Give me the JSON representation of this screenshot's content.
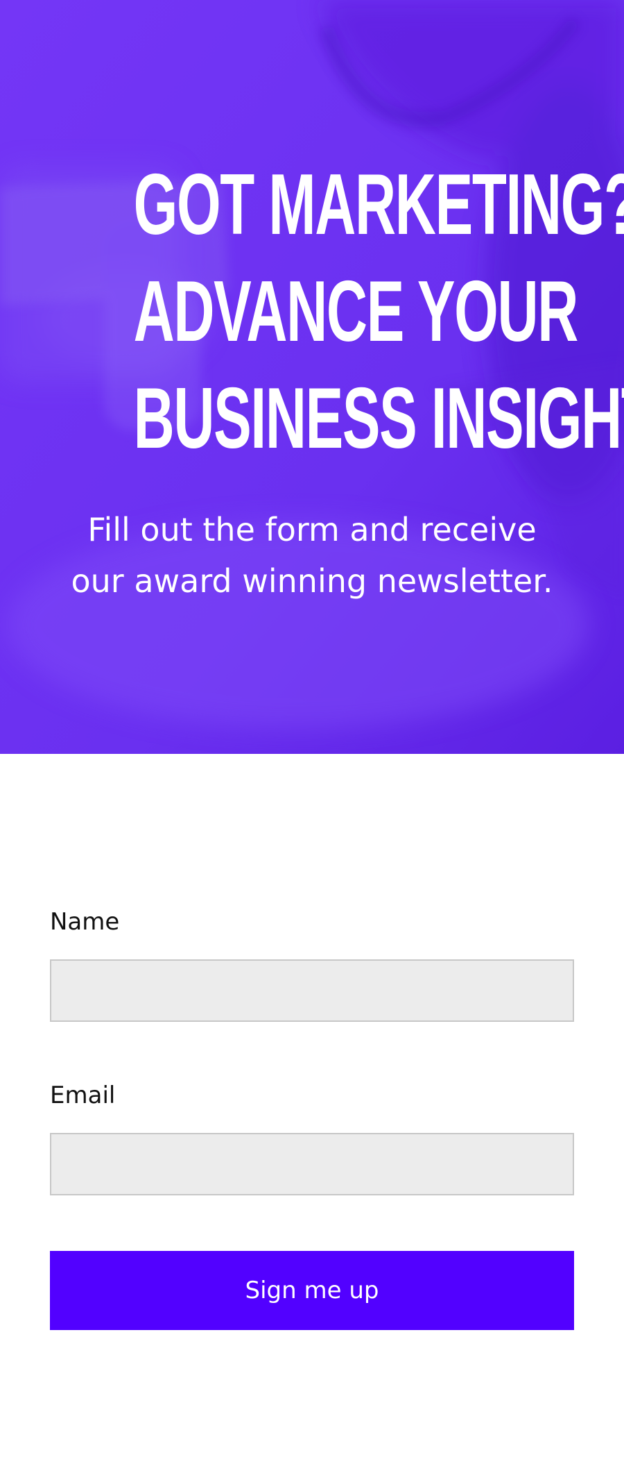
{
  "hero": {
    "headline_lines": [
      "GOT MARKETING?",
      "ADVANCE YOUR",
      "BUSINESS INSIGHT."
    ],
    "subtext_lines": [
      "Fill out the form and receive",
      "our award winning newsletter."
    ],
    "background_color": "#6f35f4",
    "background_image_icon": "blurred-desk-photo"
  },
  "form": {
    "name_label": "Name",
    "name_value": "",
    "email_label": "Email",
    "email_value": "",
    "submit_label": "Sign me up",
    "button_color": "#5201ff",
    "input_background": "#ececec"
  }
}
